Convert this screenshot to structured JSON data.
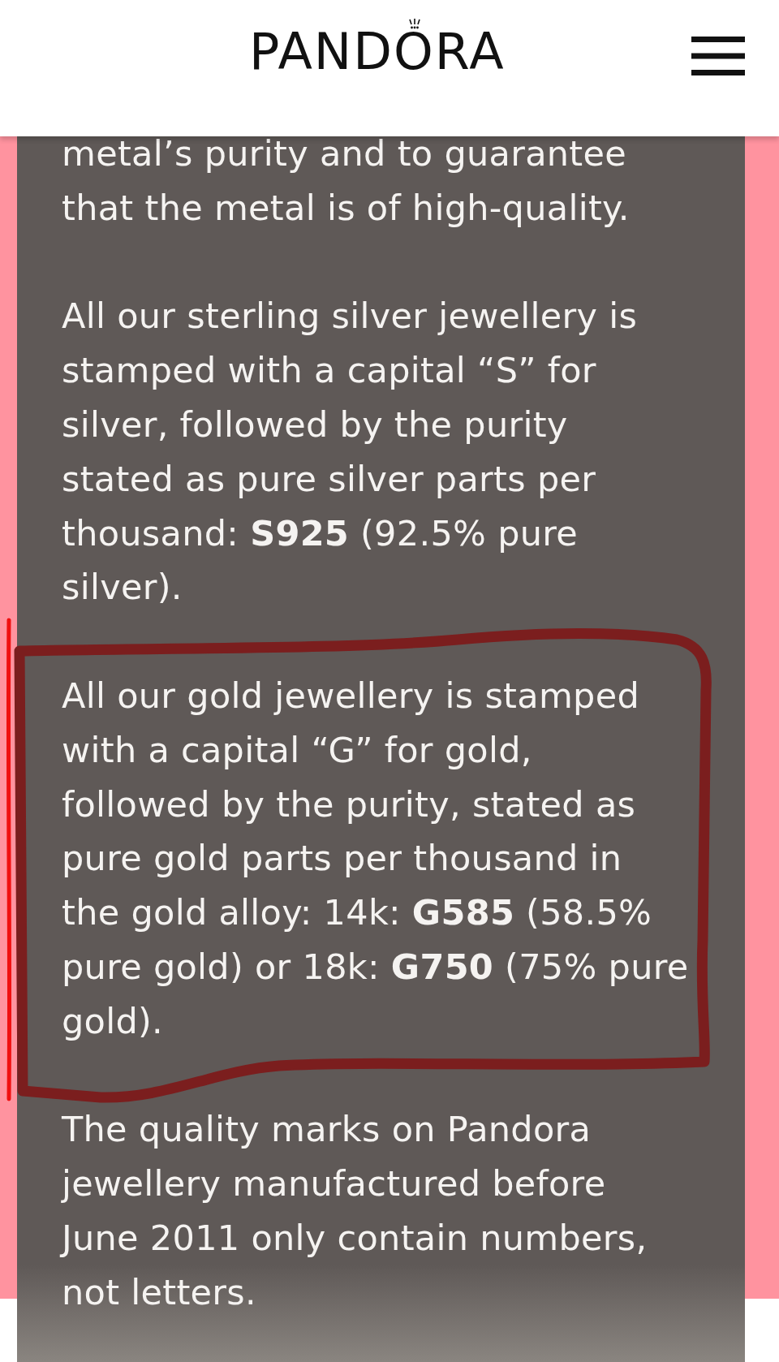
{
  "header": {
    "logo": "PANDORA"
  },
  "article": {
    "paragraphs": [
      {
        "lines": [
          "metal’s purity and to guarantee",
          "that the metal is of high-quality."
        ],
        "highlighted": false
      },
      {
        "lines": [
          "All our sterling silver jewellery is",
          "stamped with a capital “S” for",
          "silver, followed by the purity",
          "stated as pure silver parts per",
          "thousand: **S925** (92.5% pure",
          "silver)."
        ],
        "highlighted": false
      },
      {
        "lines": [
          "All our gold jewellery is stamped",
          "with a capital “G” for gold,",
          "followed by the purity, stated as",
          "pure gold parts per thousand in",
          "the gold alloy: 14k: **G585** (58.5%",
          "pure gold) or 18k: **G750** (75% pure",
          "gold)."
        ],
        "highlighted": true
      },
      {
        "lines": [
          "The quality marks on Pandora",
          "jewellery manufactured before",
          "June 2011 only contain numbers,",
          "not letters."
        ],
        "highlighted": false
      }
    ]
  }
}
